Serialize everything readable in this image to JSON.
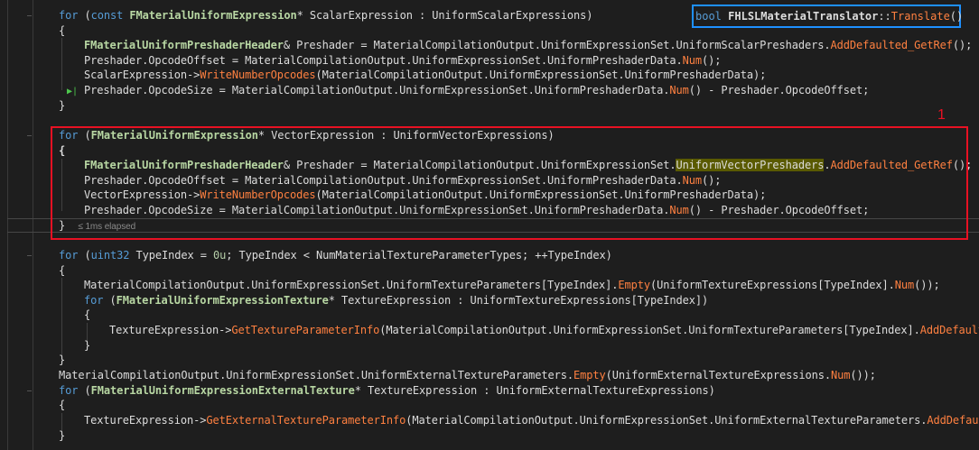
{
  "nav": {
    "return_type": "bool",
    "class_name": "FHLSLMaterialTranslator",
    "sep": "::",
    "method": "Translate",
    "parens": "()"
  },
  "annotation": {
    "label": "1"
  },
  "perf": {
    "elapsed": "≤ 1ms elapsed"
  },
  "colors": {
    "highlight_box": "#e81123",
    "nav_box": "#1e90ff"
  },
  "code": {
    "l1": [
      "for",
      " (",
      "const",
      " ",
      "FMaterialUniformExpression",
      "* ScalarExpression : UniformScalarExpressions)"
    ],
    "l2": "{",
    "l3": [
      "FMaterialUniformPreshaderHeader",
      "& Preshader = MaterialCompilationOutput.UniformExpressionSet.UniformScalarPreshaders.",
      "AddDefaulted_GetRef",
      "();"
    ],
    "l4": [
      "Preshader.OpcodeOffset = MaterialCompilationOutput.UniformExpressionSet.UniformPreshaderData.",
      "Num",
      "();"
    ],
    "l5": [
      "ScalarExpression->",
      "WriteNumberOpcodes",
      "(MaterialCompilationOutput.UniformExpressionSet.UniformPreshaderData);"
    ],
    "l6": [
      "Preshader.OpcodeSize = MaterialCompilationOutput.UniformExpressionSet.UniformPreshaderData.",
      "Num",
      "() - Preshader.OpcodeOffset;"
    ],
    "l7": "}",
    "l8": [
      "for",
      " (",
      "FMaterialUniformExpression",
      "* VectorExpression : UniformVectorExpressions)"
    ],
    "l9": "{",
    "l10": [
      "FMaterialUniformPreshaderHeader",
      "& Preshader = MaterialCompilationOutput.UniformExpressionSet.",
      "UniformVectorPreshaders",
      ".",
      "AddDefaulted_GetRef",
      "();"
    ],
    "l11": [
      "Preshader.OpcodeOffset = MaterialCompilationOutput.UniformExpressionSet.UniformPreshaderData.",
      "Num",
      "();"
    ],
    "l12": [
      "VectorExpression->",
      "WriteNumberOpcodes",
      "(MaterialCompilationOutput.UniformExpressionSet.UniformPreshaderData);"
    ],
    "l13": [
      "Preshader.OpcodeSize = MaterialCompilationOutput.UniformExpressionSet.UniformPreshaderData.",
      "Num",
      "() - Preshader.OpcodeOffset;"
    ],
    "l14": "}",
    "l15": [
      "for",
      " (",
      "uint32",
      " TypeIndex = ",
      "0u",
      "; TypeIndex < NumMaterialTextureParameterTypes; ++TypeIndex)"
    ],
    "l16": "{",
    "l17": [
      "MaterialCompilationOutput.UniformExpressionSet.UniformTextureParameters[TypeIndex].",
      "Empty",
      "(UniformTextureExpressions[TypeIndex].",
      "Num",
      "());"
    ],
    "l18": [
      "for",
      " (",
      "FMaterialUniformExpressionTexture",
      "* TextureExpression : UniformTextureExpressions[TypeIndex])"
    ],
    "l19": "{",
    "l20": [
      "TextureExpression->",
      "GetTextureParameterInfo",
      "(MaterialCompilationOutput.UniformExpressionSet.UniformTextureParameters[TypeIndex].",
      "AddDefaulted"
    ],
    "l21": "}",
    "l22": "}",
    "l23": [
      "MaterialCompilationOutput.UniformExpressionSet.UniformExternalTextureParameters.",
      "Empty",
      "(UniformExternalTextureExpressions.",
      "Num",
      "());"
    ],
    "l24": [
      "for",
      " (",
      "FMaterialUniformExpressionExternalTexture",
      "* TextureExpression : UniformExternalTextureExpressions)"
    ],
    "l25": "{",
    "l26": [
      "TextureExpression->",
      "GetExternalTextureParameterInfo",
      "(MaterialCompilationOutput.UniformExpressionSet.UniformExternalTextureParameters.",
      "AddDefaulte"
    ],
    "l27": "}"
  }
}
